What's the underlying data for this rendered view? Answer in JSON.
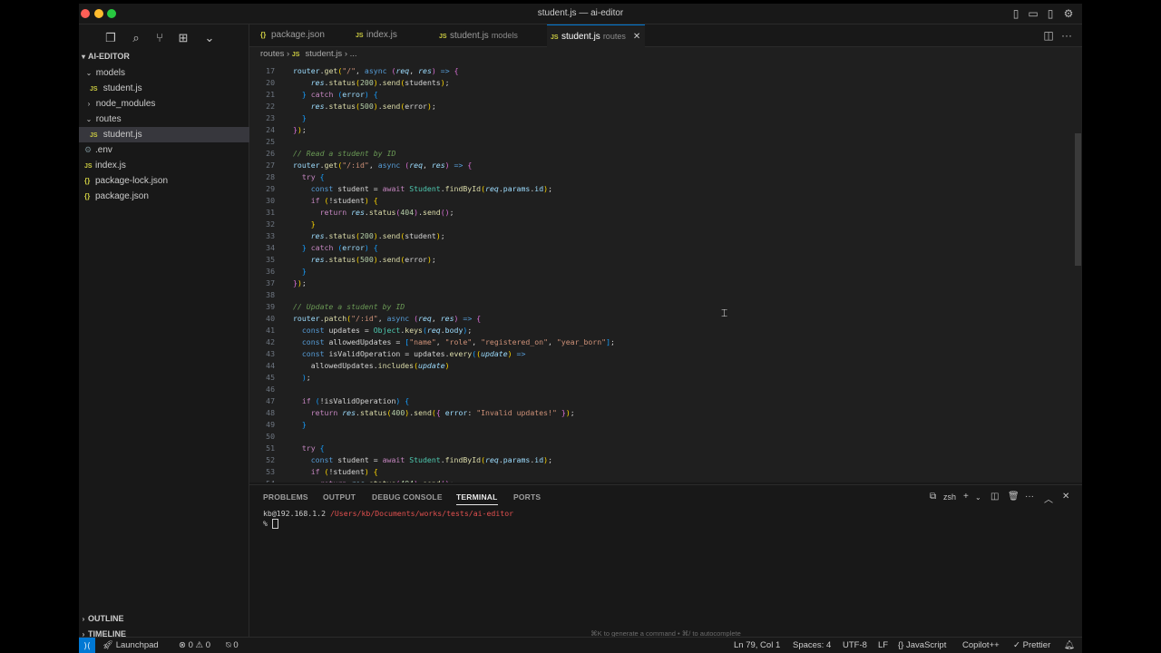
{
  "window": {
    "title": "student.js — ai-editor"
  },
  "traffic_lights": {
    "close": "#ff5f57",
    "minimize": "#febc2e",
    "maximize": "#28c840"
  },
  "sidebar": {
    "root": "AI-EDITOR",
    "items": [
      {
        "label": "models",
        "type": "folder",
        "open": true
      },
      {
        "label": "student.js",
        "type": "js"
      },
      {
        "label": "node_modules",
        "type": "folder",
        "open": false
      },
      {
        "label": "routes",
        "type": "folder",
        "open": true
      },
      {
        "label": "student.js",
        "type": "js",
        "selected": true
      },
      {
        "label": ".env",
        "type": "env"
      },
      {
        "label": "index.js",
        "type": "js"
      },
      {
        "label": "package-lock.json",
        "type": "json"
      },
      {
        "label": "package.json",
        "type": "json"
      }
    ],
    "outline": "OUTLINE",
    "timeline": "TIMELINE"
  },
  "tabs": [
    {
      "icon": "{}",
      "label": "package.json",
      "sub": ""
    },
    {
      "icon": "JS",
      "label": "index.js",
      "sub": ""
    },
    {
      "icon": "JS",
      "label": "student.js",
      "sub": "models"
    },
    {
      "icon": "JS",
      "label": "student.js",
      "sub": "routes",
      "active": true
    }
  ],
  "breadcrumb": {
    "folder": "routes",
    "file": "student.js",
    "tail": "..."
  },
  "code": {
    "line_numbers": [
      "17",
      "20",
      "21",
      "22",
      "23",
      "24",
      "25",
      "26",
      "27",
      "28",
      "29",
      "30",
      "31",
      "32",
      "33",
      "34",
      "35",
      "36",
      "37",
      "38",
      "39",
      "40",
      "41",
      "42",
      "43",
      "44",
      "45",
      "46",
      "47",
      "48",
      "49",
      "50",
      "51",
      "52",
      "53",
      "54"
    ]
  },
  "panel": {
    "tabs": [
      "PROBLEMS",
      "OUTPUT",
      "DEBUG CONSOLE",
      "TERMINAL",
      "PORTS"
    ],
    "active_tab": "TERMINAL",
    "shell": "zsh",
    "prompt_host": "kb@192.168.1.2",
    "prompt_path": "/Users/kb/Documents/works/tests/ai-editor",
    "prompt_char": "%",
    "hint": "⌘K to generate a command • ⌘/ to autocomplete"
  },
  "statusbar": {
    "launchpad": "Launchpad",
    "errors": "0",
    "warnings": "0",
    "ports": "0",
    "position": "Ln 79, Col 1",
    "spaces": "Spaces: 4",
    "encoding": "UTF-8",
    "eol": "LF",
    "language_brace": "{}",
    "language": "JavaScript",
    "copilot": "Copilot++",
    "prettier": "Prettier"
  }
}
